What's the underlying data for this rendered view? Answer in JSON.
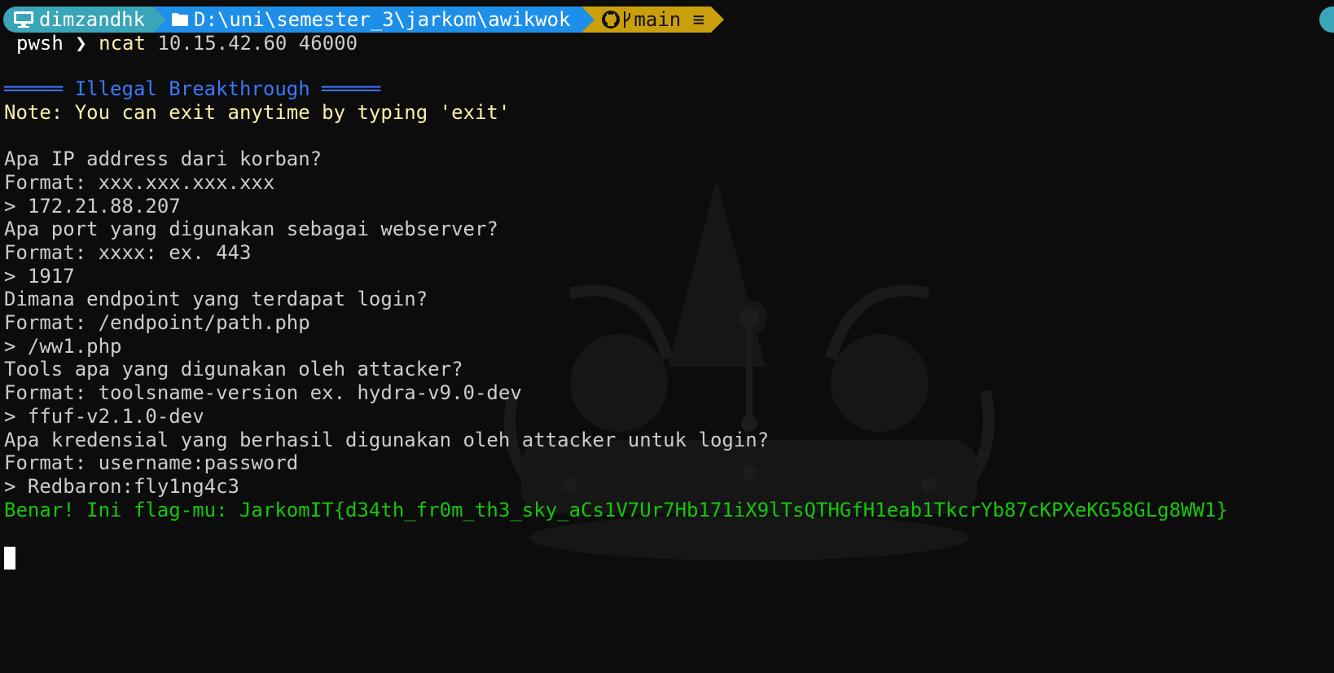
{
  "prompt": {
    "user": "dimzandhk",
    "path": "D:\\uni\\semester_3\\jarkom\\awikwok",
    "branch": "main ≡",
    "icons": [
      "monitor-icon",
      "folder-icon",
      "github-icon",
      "git-branch-icon"
    ]
  },
  "command": {
    "shell": "pwsh",
    "chevron": "❯",
    "program": "ncat",
    "args": " 10.15.42.60 46000"
  },
  "output": {
    "title": "═════ Illegal Breakthrough ═════",
    "note": "Note: You can exit anytime by typing 'exit'",
    "q1": "Apa IP address dari korban?",
    "f1": "Format: xxx.xxx.xxx.xxx",
    "a1": "> 172.21.88.207",
    "q2": "Apa port yang digunakan sebagai webserver?",
    "f2": "Format: xxxx: ex. 443",
    "a2": "> 1917",
    "q3": "Dimana endpoint yang terdapat login?",
    "f3": "Format: /endpoint/path.php",
    "a3": "> /ww1.php",
    "q4": "Tools apa yang digunakan oleh attacker?",
    "f4": "Format: toolsname-version ex. hydra-v9.0-dev",
    "a4": "> ffuf-v2.1.0-dev",
    "q5": "Apa kredensial yang berhasil digunakan oleh attacker untuk login?",
    "f5": "Format: username:password",
    "a5": "> Redbaron:fly1ng4c3",
    "result": "Benar! Ini flag-mu: JarkomIT{d34th_fr0m_th3_sky_aCs1V7Ur7Hb171iX9lTsQTHGfH1eab1TkcrYb87cKPXeKG58GLg8WW1}"
  },
  "colors": {
    "background": "#0c0c0c",
    "text": "#cccccc",
    "title": "#3b78ff",
    "note": "#f9f1a5",
    "success": "#16c60c",
    "seg_user": "#3aa5b8",
    "seg_path": "#1e8fe8",
    "seg_git": "#c9a00b"
  }
}
